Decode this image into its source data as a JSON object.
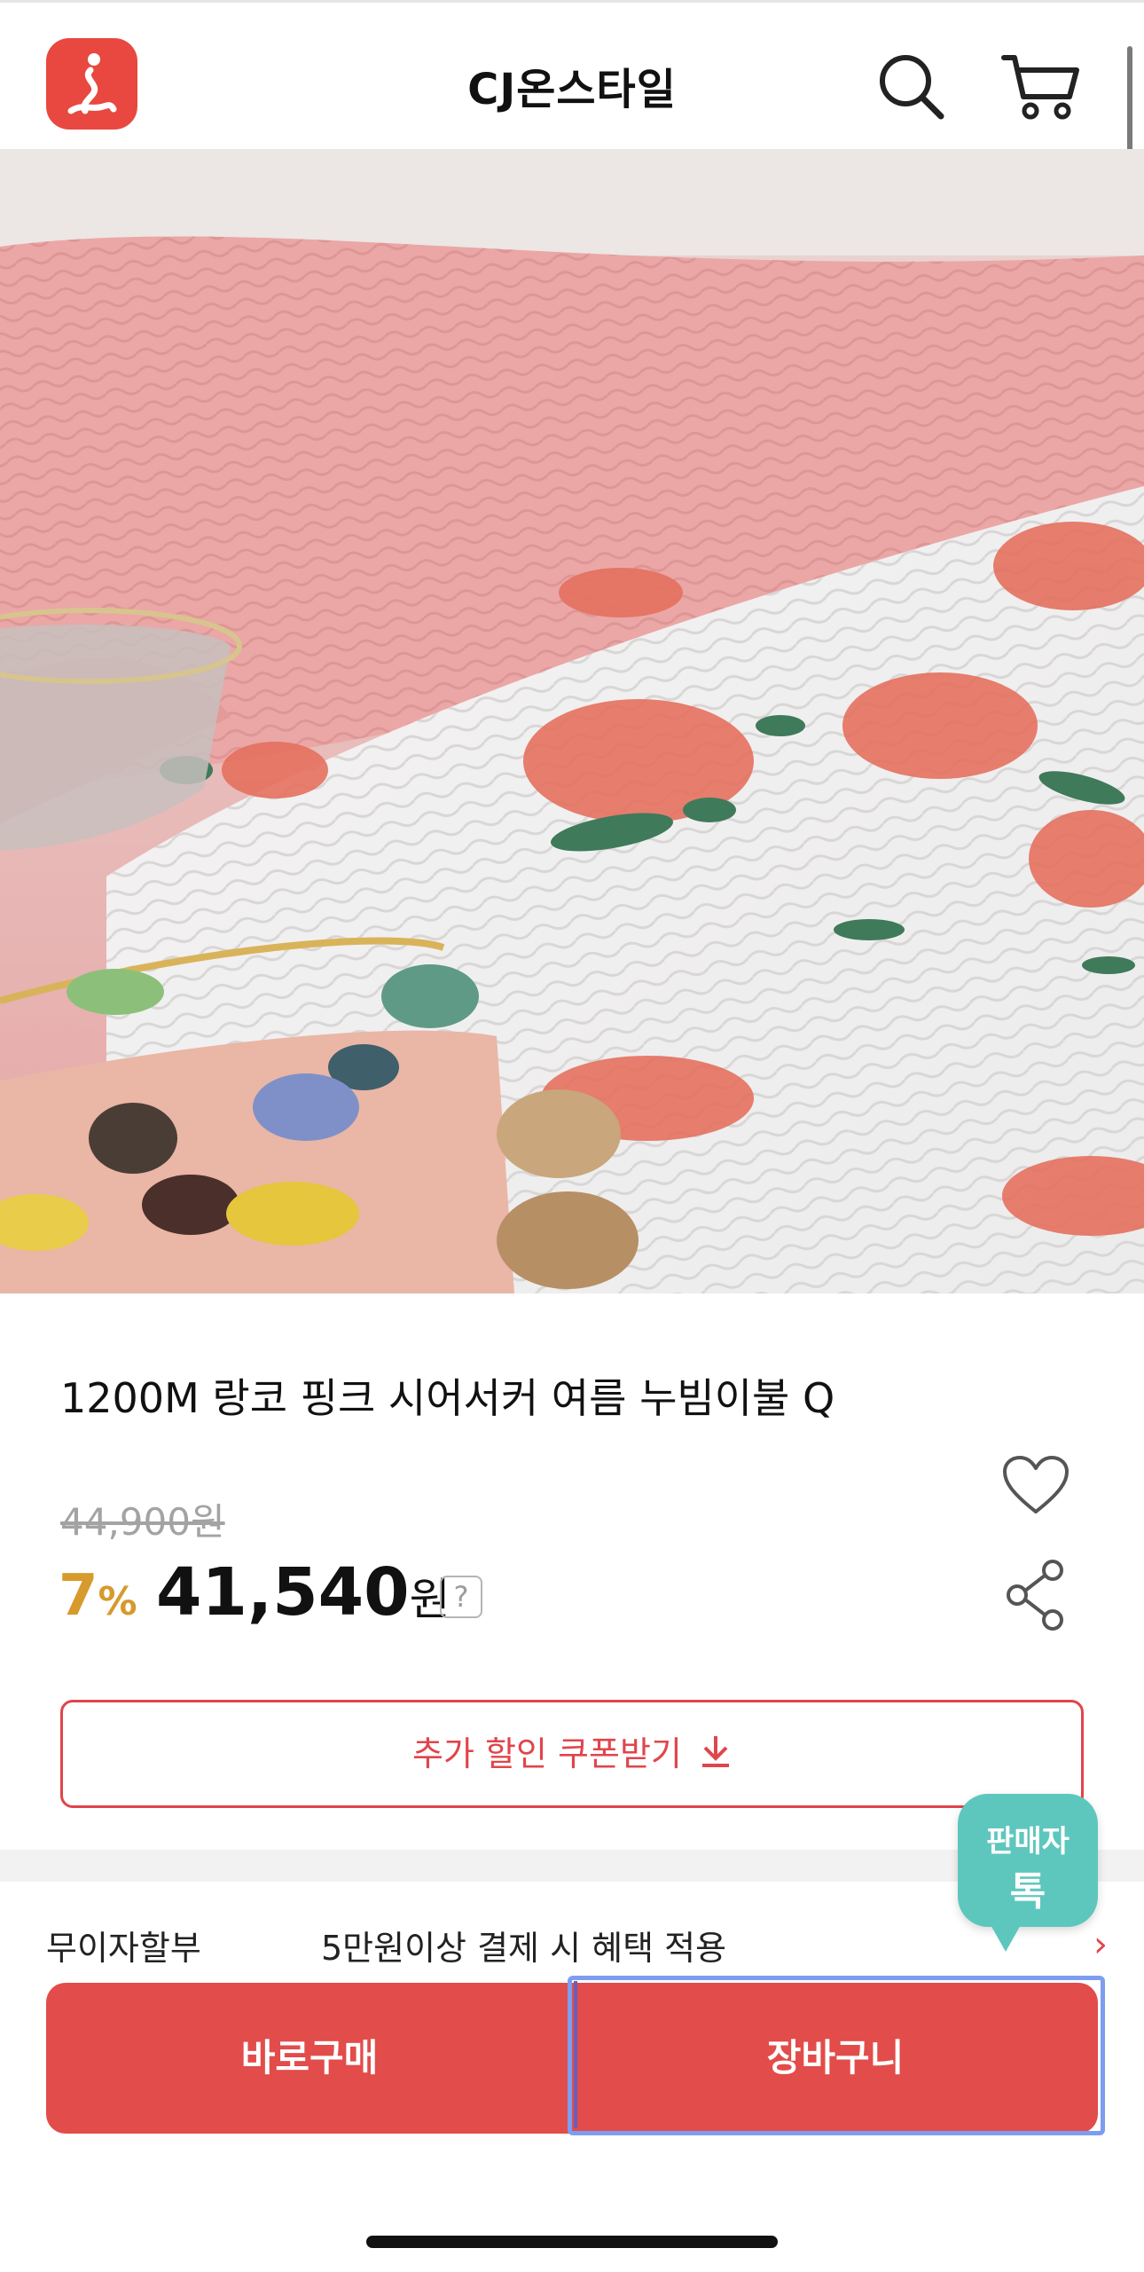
{
  "header": {
    "title": "CJ온스타일",
    "brand_color": "#e8483f"
  },
  "product": {
    "title": "1200M 랑코 핑크 시어서커 여름 누빔이불 Q",
    "original_price": "44,900원",
    "discount_number": "7",
    "discount_unit": "%",
    "sale_price": "41,540",
    "sale_unit": "원",
    "help_label": "?",
    "coupon_label": "추가 할인 쿠폰받기"
  },
  "benefit": {
    "label": "무이자할부",
    "text": "5만원이상 결제 시 혜택 적용",
    "chevron": "›"
  },
  "seller_talk": {
    "line1": "판매자",
    "line2": "톡",
    "color": "#5ec7bd"
  },
  "actions": {
    "buy_label": "바로구매",
    "cart_label": "장바구니",
    "color": "#e24c4a"
  },
  "icons": {
    "logo": "cj-onstyle-logo-icon",
    "search": "search-icon",
    "cart": "cart-icon",
    "wish": "heart-icon",
    "share": "share-icon",
    "download": "download-icon"
  }
}
